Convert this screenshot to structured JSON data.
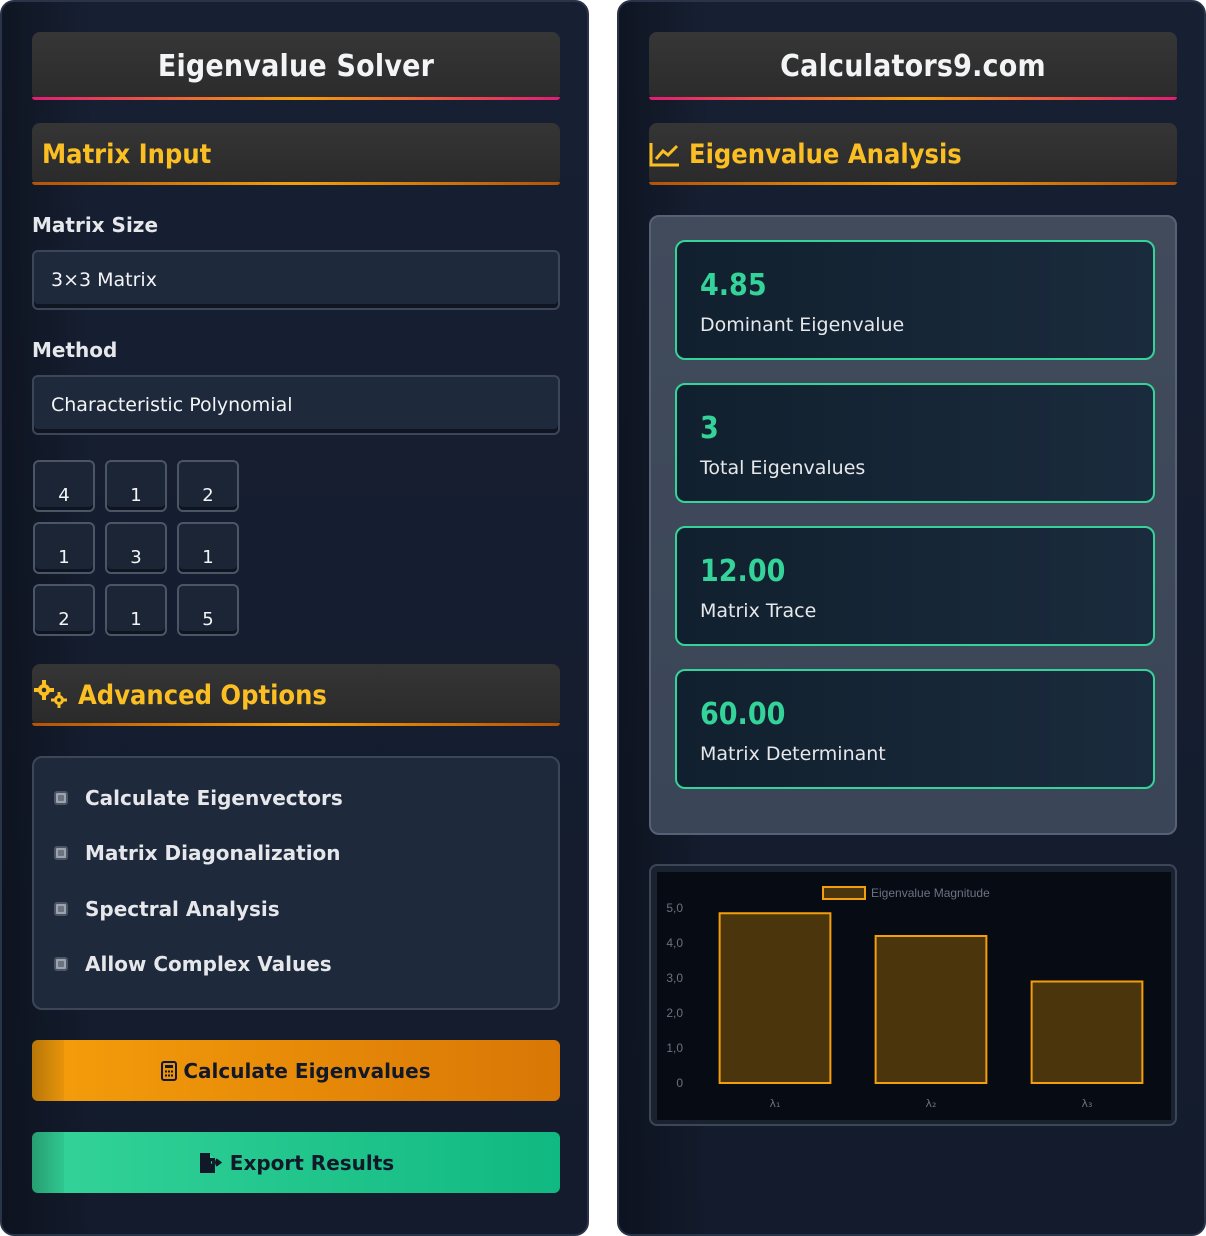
{
  "left": {
    "title": "Eigenvalue Solver",
    "matrix_input_heading": "Matrix Input",
    "matrix_size_label": "Matrix Size",
    "matrix_size_value": "3×3 Matrix",
    "method_label": "Method",
    "method_value": "Characteristic Polynomial",
    "matrix": [
      [
        "4",
        "1",
        "2"
      ],
      [
        "1",
        "3",
        "1"
      ],
      [
        "2",
        "1",
        "5"
      ]
    ],
    "advanced_heading": "Advanced Options",
    "options": [
      {
        "label": "Calculate Eigenvectors"
      },
      {
        "label": "Matrix Diagonalization"
      },
      {
        "label": "Spectral Analysis"
      },
      {
        "label": "Allow Complex Values"
      }
    ],
    "calculate_button": "Calculate Eigenvalues",
    "export_button": "Export Results"
  },
  "right": {
    "title": "Calculators9.com",
    "analysis_heading": "Eigenvalue Analysis",
    "stats": [
      {
        "value": "4.85",
        "label": "Dominant Eigenvalue"
      },
      {
        "value": "3",
        "label": "Total Eigenvalues"
      },
      {
        "value": "12.00",
        "label": "Matrix Trace"
      },
      {
        "value": "60.00",
        "label": "Matrix Determinant"
      }
    ]
  },
  "colors": {
    "bar_fill": "#4a350d",
    "bar_stroke": "#f59e0b",
    "accent_green": "#34d399",
    "accent_gold": "#fbbf24"
  },
  "chart_data": {
    "type": "bar",
    "categories": [
      "λ₁",
      "λ₂",
      "λ₃"
    ],
    "series": [
      {
        "name": "Eigenvalue Magnitude",
        "values": [
          4.85,
          4.2,
          2.9
        ]
      }
    ],
    "yticks": [
      "5,0",
      "4,0",
      "3,0",
      "2,0",
      "1,0",
      "0"
    ],
    "ylim": [
      0,
      5
    ],
    "grid": false,
    "legend": "top-center"
  }
}
